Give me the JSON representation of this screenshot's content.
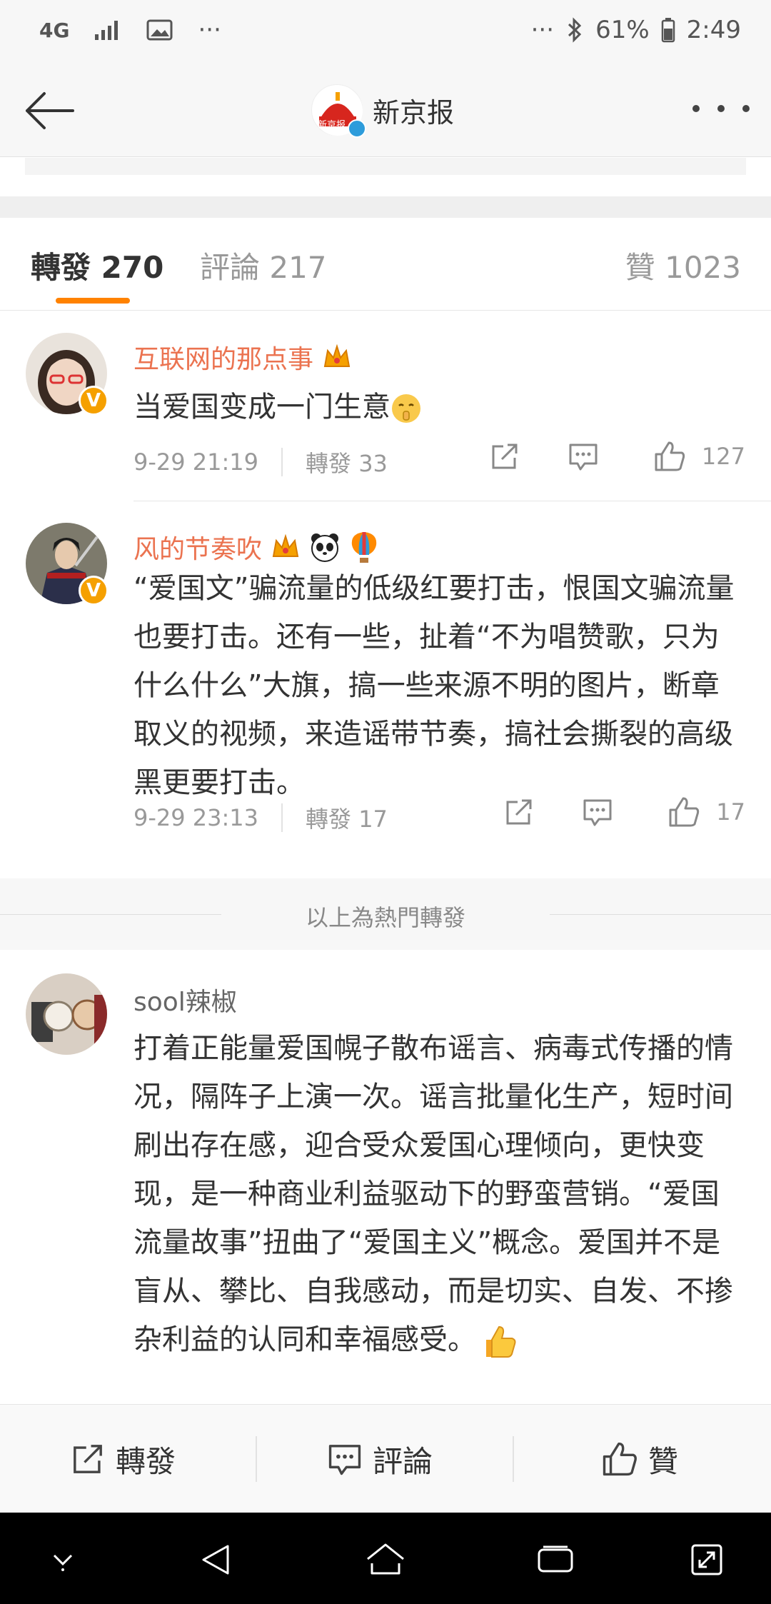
{
  "status_bar": {
    "network": "4G",
    "more": "···",
    "right_more": "···",
    "battery_percent": "61%",
    "time": "2:49"
  },
  "nav": {
    "title": "新京报",
    "avatar_text": "新京报"
  },
  "tabs": {
    "repost": "轉發 270",
    "comment": "評論 217",
    "like": "贊 1023"
  },
  "comments": [
    {
      "username": "互联网的那点事",
      "text": "当爱国变成一门生意",
      "time": "9-29 21:19",
      "repost": "轉發 33",
      "likes": "127"
    },
    {
      "username": "风的节奏吹",
      "text": "“爱国文”骗流量的低级红要打击，恨国文骗流量也要打击。还有一些，扯着“不为唱赞歌，只为什么什么”大旗，搞一些来源不明的图片，断章取义的视频，来造谣带节奏，搞社会撕裂的高级黑更要打击。",
      "time": "9-29 23:13",
      "repost": "轉發 17",
      "likes": "17"
    },
    {
      "username": "sool辣椒",
      "text": "打着正能量爱国幌子散布谣言、病毒式传播的情况，隔阵子上演一次。谣言批量化生产，短时间刷出存在感，迎合受众爱国心理倾向，更快变现，是一种商业利益驱动下的野蛮营销。“爱国流量故事”扭曲了“爱国主义”概念。爱国并不是盲从、攀比、自我感动，而是切实、自发、不掺杂利益的认同和幸福感受。"
    }
  ],
  "hot_separator": "以上為熱門轉發",
  "bottom_bar": {
    "repost": "轉發",
    "comment": "評論",
    "like": "贊"
  },
  "colors": {
    "accent": "#ff8200",
    "username": "#eb7350",
    "verified": "#f5a000"
  }
}
